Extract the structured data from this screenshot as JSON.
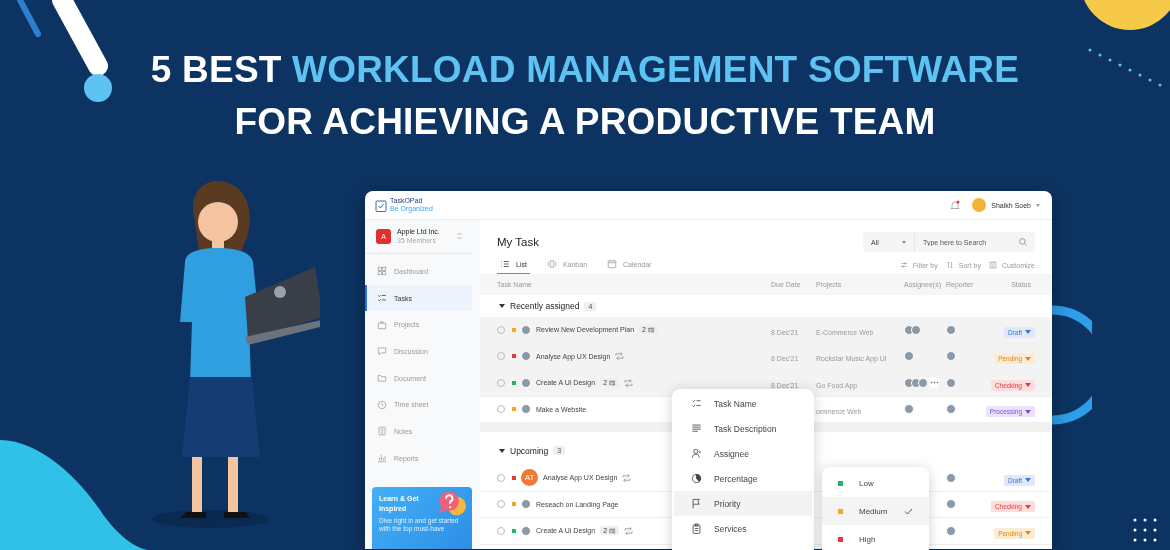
{
  "headline": {
    "line_1": [
      {
        "text": "5 BEST",
        "accent": false
      },
      {
        "text": "WORKLOAD MANAGEMENT SOFTWARE",
        "accent": true
      }
    ],
    "line_2": [
      {
        "text": "FOR ACHIEVING A PRODUCTIVE TEAM",
        "accent": false
      }
    ]
  },
  "app": {
    "logo": {
      "name": "TaskOPad",
      "tagline": "Be Organized"
    },
    "notifications": {
      "unread": true
    },
    "user": {
      "name": "Shaikh Soeb"
    },
    "organization": {
      "initial": "A",
      "name": "Apple Ltd Inc.",
      "members": "35 Members"
    },
    "sidebar": {
      "items": [
        {
          "label": "Dashboard",
          "kind": "dashboard",
          "selected": false
        },
        {
          "label": "Tasks",
          "kind": "tasks",
          "selected": true
        },
        {
          "label": "Projects",
          "kind": "projects",
          "selected": false
        },
        {
          "label": "Discussion",
          "kind": "discussion",
          "selected": false
        },
        {
          "label": "Document",
          "kind": "document",
          "selected": false
        },
        {
          "label": "Time sheet",
          "kind": "timesheet",
          "selected": false
        },
        {
          "label": "Notes",
          "kind": "notes",
          "selected": false
        },
        {
          "label": "Reports",
          "kind": "reports",
          "selected": false
        }
      ]
    },
    "promo": {
      "title": "Learn & Get Inspired",
      "text": "Dive right in and get started with the top must-have"
    },
    "page_title": "My Task",
    "view_tabs": [
      {
        "label": "List",
        "kind": "list",
        "selected": true
      },
      {
        "label": "Kanban",
        "kind": "kanban",
        "selected": false
      },
      {
        "label": "Calendar",
        "kind": "calendar",
        "selected": false
      }
    ],
    "filter_select": {
      "value": "All"
    },
    "search": {
      "placeholder": "Type here to Search"
    },
    "toolbar": [
      {
        "label": "Filter by",
        "kind": "filter"
      },
      {
        "label": "Sort by",
        "kind": "sort"
      },
      {
        "label": "Customize",
        "kind": "customize"
      }
    ],
    "columns": [
      "Task Name",
      "Due Date",
      "Projects",
      "Assignee(s)",
      "Reporter",
      "Status"
    ],
    "groups": [
      {
        "title": "Recently assigned",
        "count": "4",
        "expanded": true,
        "rows": [
          {
            "task": "Review New Development Plan",
            "color": "#f5a623",
            "owner": {
              "kind": "photo"
            },
            "subtasks": "2",
            "repeat": false,
            "highlighted": true,
            "due": "8 Dec'21",
            "project": "E-Commerce Web",
            "assignees": [
              {
                "kind": "photo"
              },
              {
                "kind": "photo"
              }
            ],
            "more_assignees": false,
            "status": {
              "label": "Draft",
              "color": "#3b74d8"
            }
          },
          {
            "task": "Analyse App UX Design",
            "color": "#e53935",
            "owner": {
              "kind": "photo"
            },
            "repeat": true,
            "highlighted": true,
            "due": "8 Dec'21",
            "project": "Rockstar Music App UI",
            "assignees": [
              {
                "kind": "photo"
              }
            ],
            "more_assignees": false,
            "status": {
              "label": "Pending",
              "color": "#e08a00"
            }
          },
          {
            "task": "Create A Ui Design",
            "color": "#1fb36b",
            "owner": {
              "kind": "photo"
            },
            "subtasks": "2",
            "repeat": true,
            "highlighted": true,
            "due": "8 Dec'21",
            "project": "Go Food App",
            "assignees": [
              {
                "kind": "photo"
              },
              {
                "kind": "photo"
              },
              {
                "kind": "photo"
              }
            ],
            "more_assignees": true,
            "status": {
              "label": "Checking",
              "color": "#e53935"
            }
          },
          {
            "task": "Make a Website",
            "color": "#f5a623",
            "owner": {
              "kind": "photo"
            },
            "repeat": false,
            "highlighted": false,
            "project": "ommerce Web",
            "assignees": [
              {
                "kind": "photo"
              }
            ],
            "more_assignees": false,
            "status": {
              "label": "Processing",
              "color": "#7a4fd8"
            }
          }
        ]
      },
      {
        "title": "Upcoming",
        "count": "3",
        "expanded": true,
        "rows": [
          {
            "task": "Analyse App UX Design",
            "color": "#e53935",
            "owner": {
              "kind": "initials",
              "initials": "AT"
            },
            "repeat": true,
            "highlighted": false,
            "assignees": [],
            "more_assignees": false,
            "status": {
              "label": "Draft",
              "color": "#3b74d8"
            }
          },
          {
            "task": "Reseach on Landing Page",
            "color": "#f5a623",
            "owner": {
              "kind": "photo"
            },
            "repeat": false,
            "highlighted": false,
            "assignees": [],
            "more_assignees": false,
            "status": {
              "label": "Checking",
              "color": "#e53935"
            }
          },
          {
            "task": "Create A Ui Design",
            "color": "#1fb36b",
            "owner": {
              "kind": "photo"
            },
            "subtasks": "2",
            "repeat": true,
            "highlighted": false,
            "assignees": [],
            "more_assignees": false,
            "status": {
              "label": "Pending",
              "color": "#e08a00"
            }
          }
        ]
      }
    ],
    "column_menu": {
      "items": [
        {
          "label": "Task Name",
          "kind": "checklist",
          "selected": false
        },
        {
          "label": "Task Description",
          "kind": "description",
          "selected": false
        },
        {
          "label": "Assignee",
          "kind": "person",
          "selected": false
        },
        {
          "label": "Percentage",
          "kind": "pie",
          "selected": false
        },
        {
          "label": "Priority",
          "kind": "flag",
          "selected": true
        },
        {
          "label": "Services",
          "kind": "clipboard",
          "selected": false
        }
      ]
    },
    "priority_menu": {
      "items": [
        {
          "label": "Low",
          "color": "#1fb36b",
          "selected": false
        },
        {
          "label": "Medium",
          "color": "#f5a623",
          "selected": true
        },
        {
          "label": "High",
          "color": "#e53935",
          "selected": false
        }
      ]
    }
  }
}
